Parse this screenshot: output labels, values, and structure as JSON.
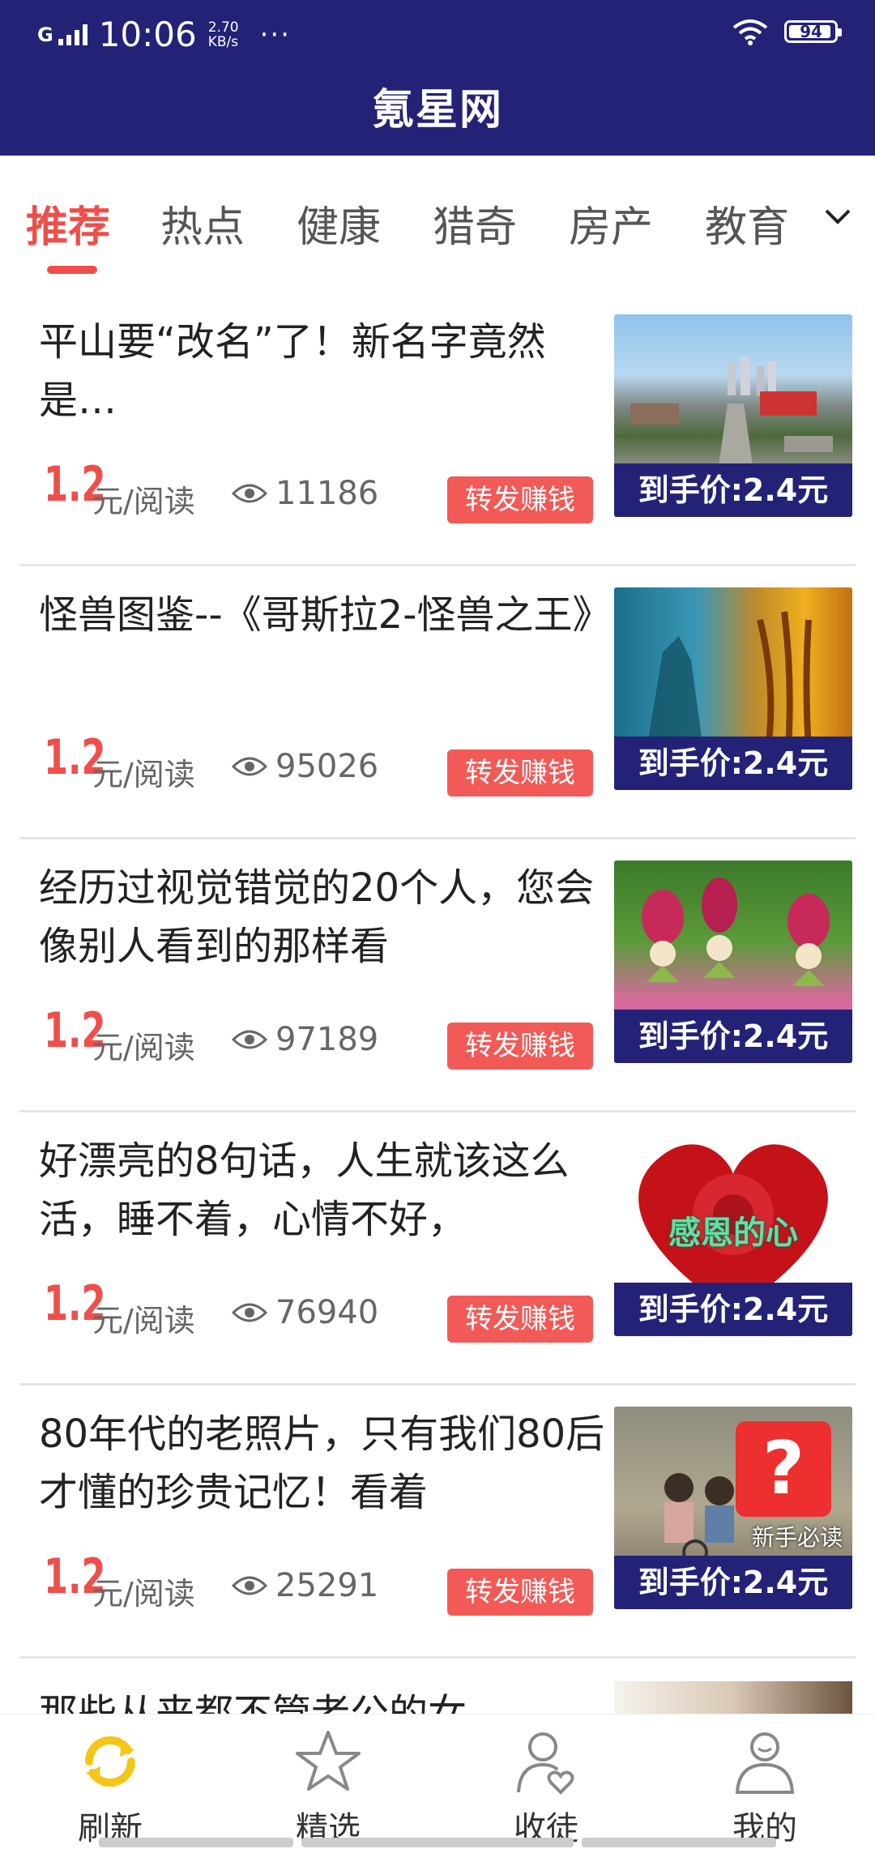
{
  "status_bar": {
    "signal": "G",
    "time": "10:06",
    "speed_value": "2.70",
    "speed_unit": "KB/s",
    "more": "···",
    "battery": "94",
    "wifi_icon": "wifi-icon"
  },
  "header": {
    "title": "氪星网"
  },
  "tabs": {
    "items": [
      {
        "label": "推荐",
        "active": true
      },
      {
        "label": "热点",
        "active": false
      },
      {
        "label": "健康",
        "active": false
      },
      {
        "label": "猎奇",
        "active": false
      },
      {
        "label": "房产",
        "active": false
      },
      {
        "label": "教育",
        "active": false
      }
    ],
    "more_icon": "chevron-down-icon"
  },
  "articles": [
    {
      "title": "平山要“改名”了！新名字竟然是…",
      "price": "1.2",
      "unit": "元/阅读",
      "views": "11186",
      "share": "转发赚钱",
      "tag": "到手价:2.4元"
    },
    {
      "title": "怪兽图鉴--《哥斯拉2-怪兽之王》",
      "price": "1.2",
      "unit": "元/阅读",
      "views": "95026",
      "share": "转发赚钱",
      "tag": "到手价:2.4元"
    },
    {
      "title": "经历过视觉错觉的20个人，您会像别人看到的那样看",
      "price": "1.2",
      "unit": "元/阅读",
      "views": "97189",
      "share": "转发赚钱",
      "tag": "到手价:2.4元"
    },
    {
      "title": "好漂亮的8句话，人生就该这么活，睡不着，心情不好，",
      "price": "1.2",
      "unit": "元/阅读",
      "views": "76940",
      "share": "转发赚钱",
      "tag": "到手价:2.4元",
      "image_text": "感恩的心"
    },
    {
      "title": "80年代的老照片，只有我们80后才懂的珍贵记忆！看着",
      "price": "1.2",
      "unit": "元/阅读",
      "views": "25291",
      "share": "转发赚钱",
      "tag": "到手价:2.4元",
      "overlay_label": "新手必读",
      "overlay_symbol": "?"
    }
  ],
  "partial_article": {
    "title": "那些从来都不管老公的女"
  },
  "bottom_nav": [
    {
      "label": "刷新",
      "icon": "refresh-icon"
    },
    {
      "label": "精选",
      "icon": "star-icon"
    },
    {
      "label": "收徒",
      "icon": "user-heart-icon"
    },
    {
      "label": "我的",
      "icon": "user-icon"
    }
  ],
  "colors": {
    "brand": "#232277",
    "accent": "#ee4f4a",
    "refresh_icon": "#f5c518"
  }
}
